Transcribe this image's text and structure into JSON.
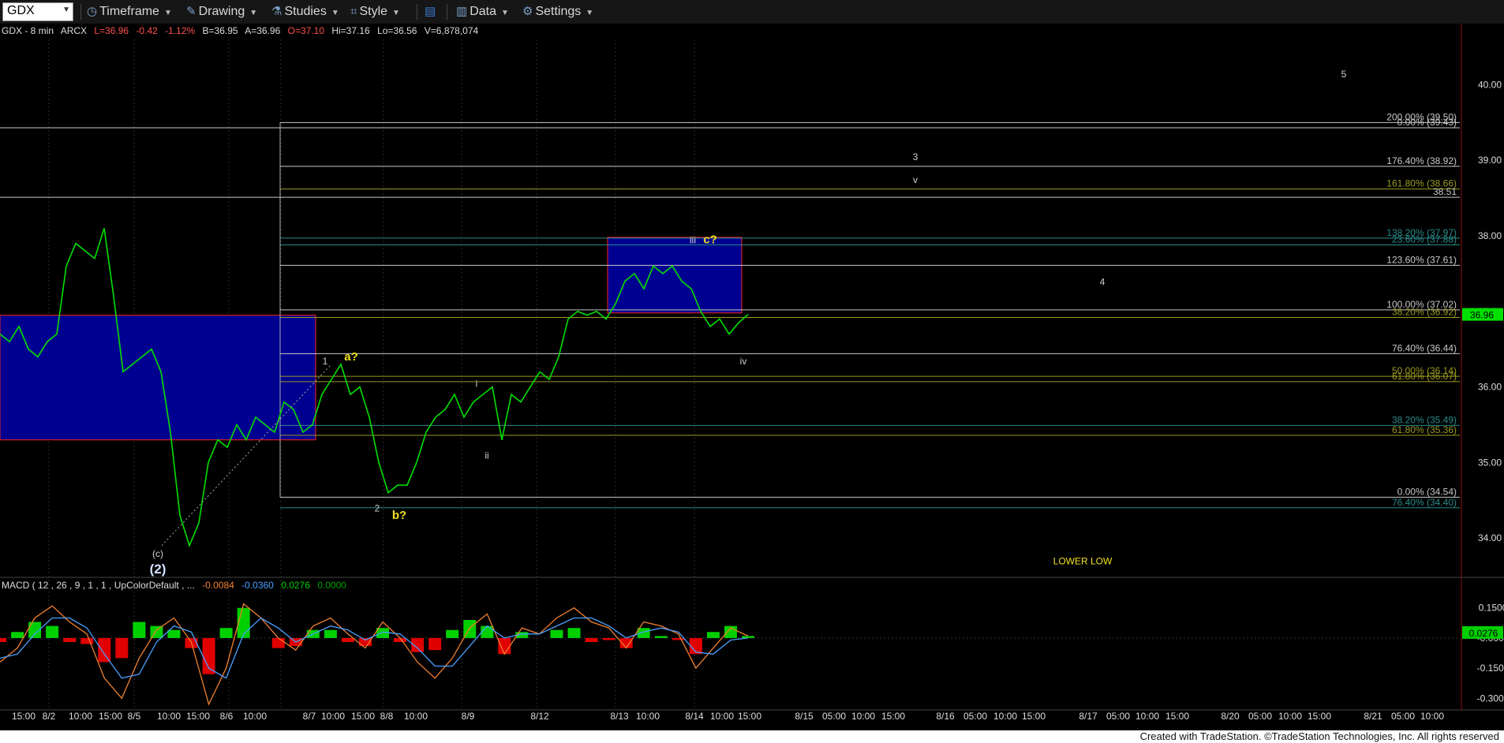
{
  "toolbar": {
    "symbol": "GDX",
    "timeframe": "Timeframe",
    "drawing": "Drawing",
    "studies": "Studies",
    "style": "Style",
    "data": "Data",
    "settings": "Settings"
  },
  "header": {
    "symbol": "GDX - 8 min",
    "exchange": "ARCX",
    "last": "L=36.96",
    "change": "-0.42",
    "pct": "-1.12%",
    "bid": "B=36.95",
    "ask": "A=36.96",
    "open": "O=37.10",
    "high": "Hi=37.16",
    "low": "Lo=36.56",
    "volume": "V=6,878,074"
  },
  "macd_header": {
    "label": "MACD ( 12 , 26 , 9 , 1 , 1 , UpColorDefault , ...",
    "v1": "-0.0084",
    "v2": "-0.0360",
    "v3": "0.0276",
    "v4": "0.0000"
  },
  "colors": {
    "price": "#00e000",
    "box": "#000090",
    "box_border": "#d02020",
    "macd_line": "#f08030",
    "signal_line": "#4aa0ff",
    "hist_up": "#00d000",
    "hist_down": "#e00000",
    "label_yellow": "#f0e020",
    "fib_white": "#c8c8c8",
    "fib_teal": "#2a8a8a",
    "fib_olive": "#9a9a20"
  },
  "chart_data": [
    {
      "type": "line",
      "title": "GDX - 8 min",
      "xlabel": "",
      "ylabel": "",
      "ylim": [
        33.5,
        40.6
      ],
      "x_tick_labels": [
        "15:00",
        "8/2",
        "10:00",
        "15:00",
        "8/5",
        "10:00",
        "15:00",
        "8/6",
        "10:00",
        "8/7",
        "10:00",
        "15:00",
        "8/8",
        "10:00",
        "8/9",
        "8/12",
        "8/13",
        "10:00",
        "8/14",
        "10:00",
        "15:00",
        "8/15",
        "05:00",
        "10:00",
        "15:00",
        "8/16",
        "05:00",
        "10:00",
        "15:00",
        "8/17",
        "05:00",
        "10:00",
        "15:00",
        "8/20",
        "05:00",
        "10:00",
        "15:00",
        "8/21",
        "05:00",
        "10:00"
      ],
      "y_tick_labels": [
        "40.00",
        "39.00",
        "38.00",
        "37.00",
        "36.00",
        "35.00",
        "34.00"
      ],
      "series": [
        {
          "values": [
            36.7,
            36.6,
            36.8,
            36.5,
            36.4,
            36.6,
            36.7,
            37.6,
            37.9,
            37.8,
            37.7,
            38.1,
            37.2,
            36.2,
            36.3,
            36.4,
            36.5,
            36.2,
            35.4,
            34.3,
            33.9,
            34.2,
            35.0,
            35.3,
            35.2,
            35.5,
            35.3,
            35.6,
            35.5,
            35.4,
            35.8,
            35.7,
            35.4,
            35.5,
            35.9,
            36.1,
            36.3,
            35.9,
            36.0,
            35.6,
            35.0,
            34.6,
            34.7,
            34.7,
            35.0,
            35.4,
            35.6,
            35.7,
            35.9,
            35.6,
            35.8,
            35.9,
            36.0,
            35.3,
            35.9,
            35.8,
            36.0,
            36.2,
            36.1,
            36.4,
            36.9,
            37.0,
            36.95,
            37.0,
            36.9,
            37.1,
            37.4,
            37.5,
            37.3,
            37.6,
            37.5,
            37.6,
            37.4,
            37.3,
            37.0,
            36.8,
            36.9,
            36.7,
            36.85,
            36.96
          ]
        }
      ],
      "fib_levels": [
        {
          "label": "200.00% (39.50)",
          "value": 39.5,
          "style": "white"
        },
        {
          "label": "0.00% (39.43)",
          "value": 39.43,
          "style": "white"
        },
        {
          "label": "176.40% (38.92)",
          "value": 38.92,
          "style": "white"
        },
        {
          "label": "161.80% (38.66)",
          "value": 38.62,
          "style": "olive"
        },
        {
          "label": "38.51",
          "value": 38.51,
          "style": "white"
        },
        {
          "label": "138.20% (37.97)",
          "value": 37.97,
          "style": "teal"
        },
        {
          "label": "23.60% (37.88)",
          "value": 37.88,
          "style": "teal"
        },
        {
          "label": "123.60% (37.61)",
          "value": 37.61,
          "style": "white"
        },
        {
          "label": "100.00% (37.02)",
          "value": 37.02,
          "style": "white"
        },
        {
          "label": "38.20% (36.92)",
          "value": 36.92,
          "style": "olive"
        },
        {
          "label": "76.40% (36.44)",
          "value": 36.44,
          "style": "white"
        },
        {
          "label": "50.00% (36.14)",
          "value": 36.14,
          "style": "olive"
        },
        {
          "label": "61.80% (36.07)",
          "value": 36.07,
          "style": "olive"
        },
        {
          "label": "38.20% (35.49)",
          "value": 35.49,
          "style": "teal"
        },
        {
          "label": "61.80% (35.36)",
          "value": 35.36,
          "style": "olive"
        },
        {
          "label": "0.00% (34.54)",
          "value": 34.54,
          "style": "white"
        },
        {
          "label": "76.40% (34.40)",
          "value": 34.4,
          "style": "teal"
        }
      ],
      "annotations": [
        {
          "text": "5",
          "value": 40.1,
          "style": "white"
        },
        {
          "text": "3",
          "value": 39.0,
          "style": "white"
        },
        {
          "text": "v",
          "value": 38.7,
          "style": "white"
        },
        {
          "text": "iii",
          "value": 37.9,
          "style": "white"
        },
        {
          "text": "c?",
          "value": 37.9,
          "style": "yellow"
        },
        {
          "text": "4",
          "value": 37.35,
          "style": "white"
        },
        {
          "text": "1",
          "value": 36.3,
          "style": "white"
        },
        {
          "text": "a?",
          "value": 36.35,
          "style": "yellow"
        },
        {
          "text": "iv",
          "value": 36.3,
          "style": "white"
        },
        {
          "text": "i",
          "value": 36.0,
          "style": "white"
        },
        {
          "text": "ii",
          "value": 35.05,
          "style": "white"
        },
        {
          "text": "2",
          "value": 34.35,
          "style": "white"
        },
        {
          "text": "b?",
          "value": 34.25,
          "style": "yellow"
        },
        {
          "text": "(c)",
          "value": 33.75,
          "style": "white"
        },
        {
          "text": "(2)",
          "value": 33.53,
          "style": "white-bold"
        },
        {
          "text": "LOWER LOW",
          "value": 33.65,
          "style": "yellow"
        }
      ],
      "current_price_label": "36.96"
    },
    {
      "type": "area",
      "title": "MACD ( 12 , 26 , 9 , 1 , 1 , UpColorDefault , ...",
      "ylim": [
        -0.35,
        0.2
      ],
      "y_tick_labels": [
        "0.1500",
        "-0.0000",
        "-0.1500",
        "-0.3000"
      ],
      "current_value_label": "0.0276",
      "series": [
        {
          "name": "MACD",
          "values": [
            -0.12,
            -0.05,
            0.1,
            0.16,
            0.08,
            0.02,
            -0.2,
            -0.3,
            -0.1,
            0.04,
            0.1,
            -0.02,
            -0.33,
            -0.15,
            0.17,
            0.1,
            0.0,
            -0.06,
            0.06,
            0.1,
            0.02,
            -0.05,
            0.08,
            0.0,
            -0.12,
            -0.2,
            -0.1,
            0.05,
            0.12,
            -0.08,
            0.05,
            0.02,
            0.1,
            0.15,
            0.08,
            0.05,
            -0.05,
            0.08,
            0.06,
            0.02,
            -0.15,
            -0.05,
            0.05,
            0.01
          ]
        },
        {
          "name": "Signal",
          "values": [
            -0.1,
            -0.08,
            0.02,
            0.1,
            0.1,
            0.05,
            -0.08,
            -0.2,
            -0.18,
            -0.02,
            0.06,
            0.03,
            -0.15,
            -0.2,
            0.02,
            0.1,
            0.05,
            -0.02,
            0.02,
            0.06,
            0.04,
            -0.01,
            0.03,
            0.02,
            -0.05,
            -0.14,
            -0.14,
            -0.04,
            0.06,
            0.0,
            0.02,
            0.02,
            0.06,
            0.1,
            0.1,
            0.06,
            0.0,
            0.03,
            0.05,
            0.03,
            -0.07,
            -0.08,
            -0.01,
            0.0
          ]
        },
        {
          "name": "Hist",
          "values": [
            -0.02,
            0.03,
            0.08,
            0.06,
            -0.02,
            -0.03,
            -0.12,
            -0.1,
            0.08,
            0.06,
            0.04,
            -0.05,
            -0.18,
            0.05,
            0.15,
            0.0,
            -0.05,
            -0.04,
            0.04,
            0.04,
            -0.02,
            -0.04,
            0.05,
            -0.02,
            -0.07,
            -0.06,
            0.04,
            0.09,
            0.06,
            -0.08,
            0.03,
            0.0,
            0.04,
            0.05,
            -0.02,
            -0.01,
            -0.05,
            0.05,
            0.01,
            -0.01,
            -0.08,
            0.03,
            0.06,
            0.01
          ]
        }
      ]
    }
  ],
  "footer": {
    "credit": "Created with TradeStation. ©TradeStation Technologies, Inc. All rights reserved"
  }
}
